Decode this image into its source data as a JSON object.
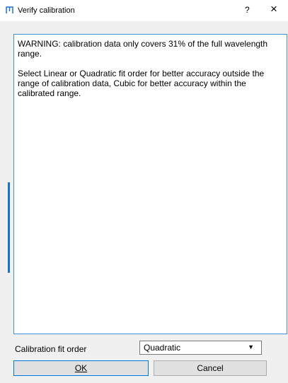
{
  "window": {
    "title": "Verify calibration",
    "help_label": "?",
    "close_label": "×"
  },
  "message": {
    "warning": "WARNING: calibration data only covers 31% of the full wavelength range.",
    "advice": "Select Linear or Quadratic fit order for better accuracy outside the range of calibration data, Cubic for better accuracy within the calibrated range."
  },
  "form": {
    "fit_order_label": "Calibration fit order",
    "fit_order_value": "Quadratic"
  },
  "buttons": {
    "ok_label": "OK",
    "cancel_label": "Cancel"
  },
  "colors": {
    "accent": "#3c8ede",
    "app_icon": "#1a72c8"
  },
  "icons": {
    "app": "app-logo-icon",
    "dropdown": "chevron-down-icon"
  }
}
